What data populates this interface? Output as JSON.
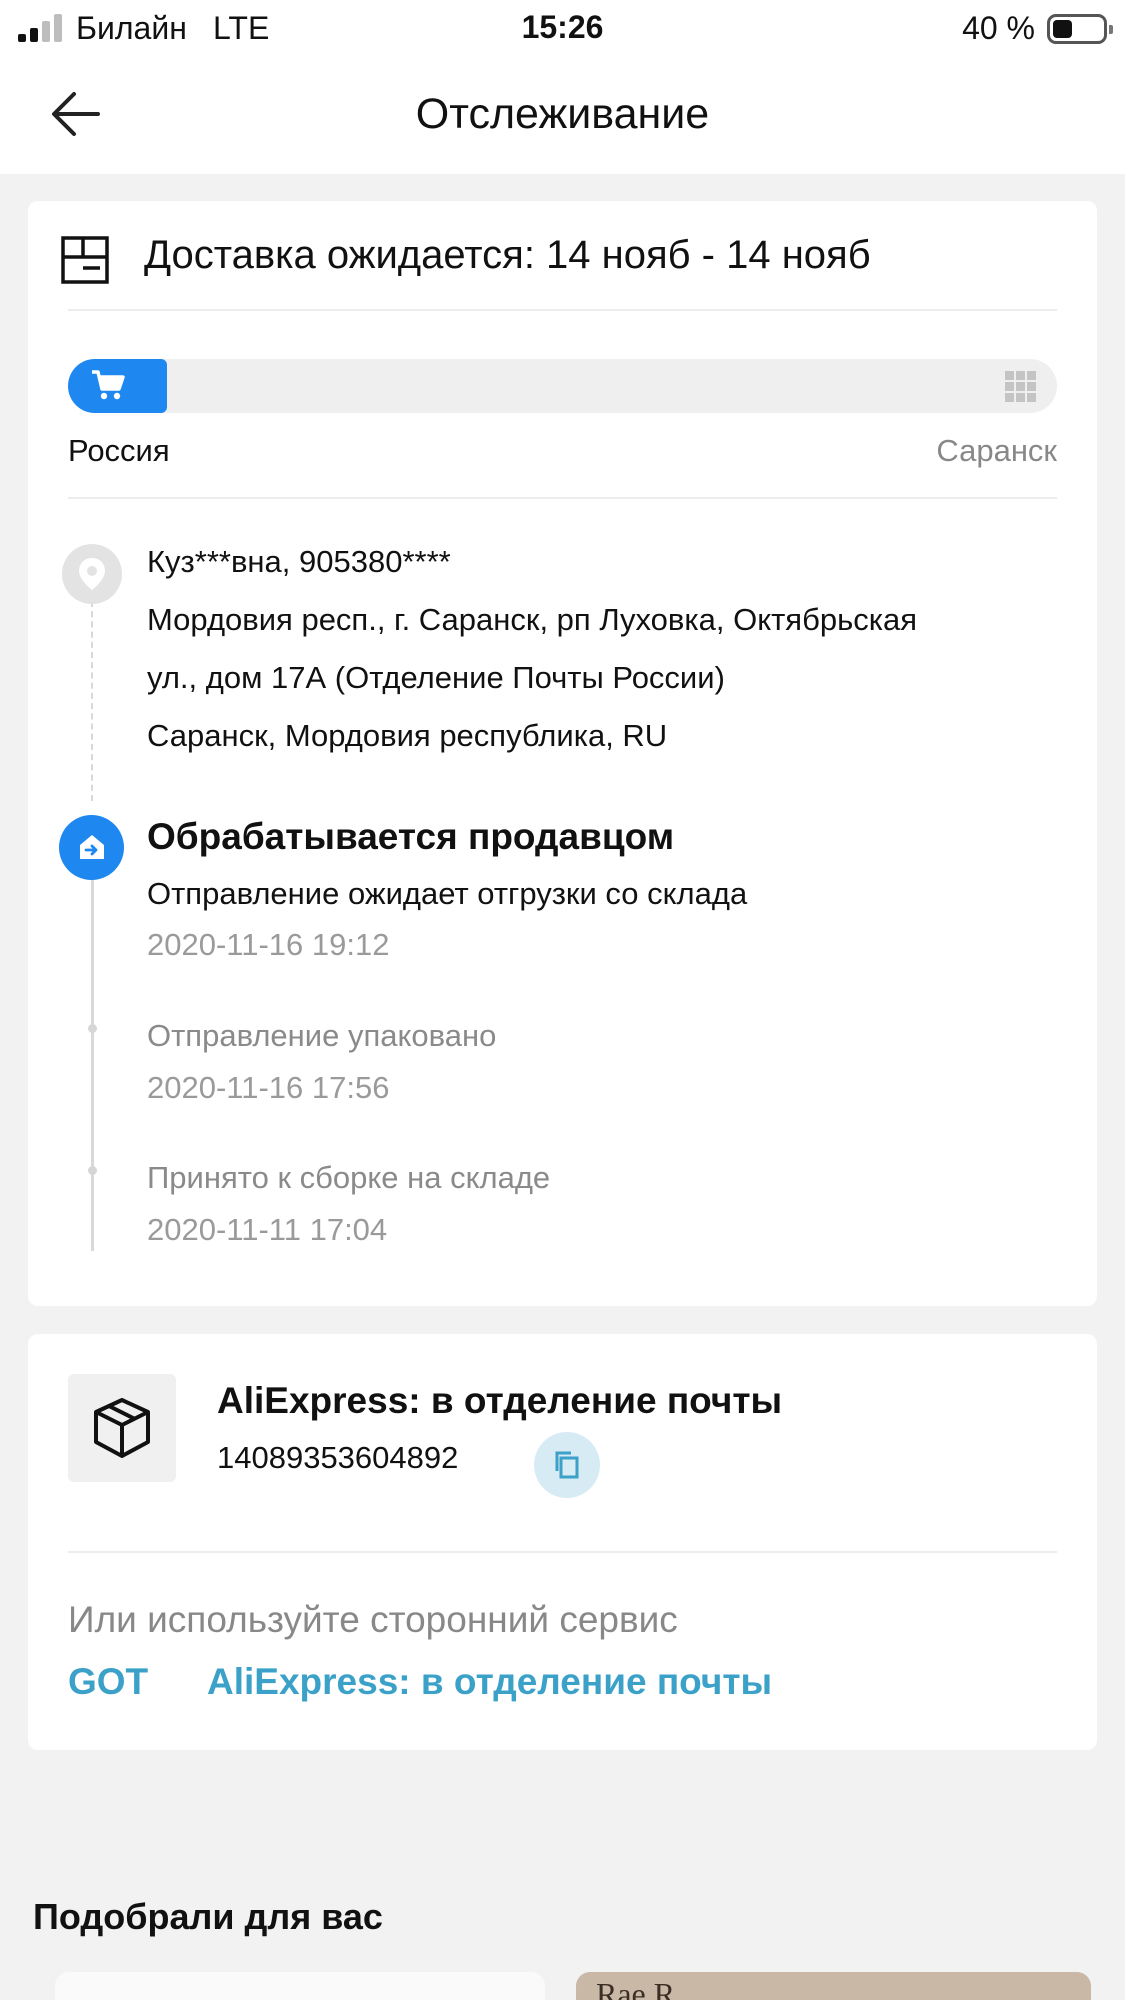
{
  "status_bar": {
    "carrier": "Билайн",
    "network": "LTE",
    "time": "15:26",
    "battery_percent": "40 %",
    "battery_level": 0.4
  },
  "header": {
    "title": "Отслеживание",
    "back_icon": "arrow-left-icon"
  },
  "tracking_card": {
    "delivery_text": "Доставка ожидается: 14 нояб - 14 нояб",
    "progress": {
      "fraction": 0.1,
      "from": "Россия",
      "to": "Саранск",
      "accent_color": "#1e88f0"
    },
    "recipient": {
      "name_phone": "Куз***вна, 905380****",
      "address_line1": "Мордовия респ., г. Саранск, рп Луховка, Октябрьская",
      "address_line2": "ул., дом 17А (Отделение Почты России)",
      "address_line3": "Саранск, Мордовия республика, RU"
    },
    "current_status": "Обрабатывается продавцом",
    "events": [
      {
        "description": "Отправление ожидает отгрузки со склада",
        "time": "2020-11-16 19:12"
      },
      {
        "description": "Отправление упаковано",
        "time": "2020-11-16 17:56"
      },
      {
        "description": "Принято к сборке на складе",
        "time": "2020-11-11 17:04"
      }
    ]
  },
  "parcel_card": {
    "carrier": "AliExpress: в отделение почты",
    "tracking_number": "14089353604892",
    "alt_hint": "Или используйте сторонний сервис",
    "links": [
      "GOT",
      "AliExpress: в отделение почты"
    ],
    "link_color": "#3ba1c8"
  },
  "recommendations": {
    "title": "Подобрали для вас",
    "thumb_text": "Rae R"
  }
}
